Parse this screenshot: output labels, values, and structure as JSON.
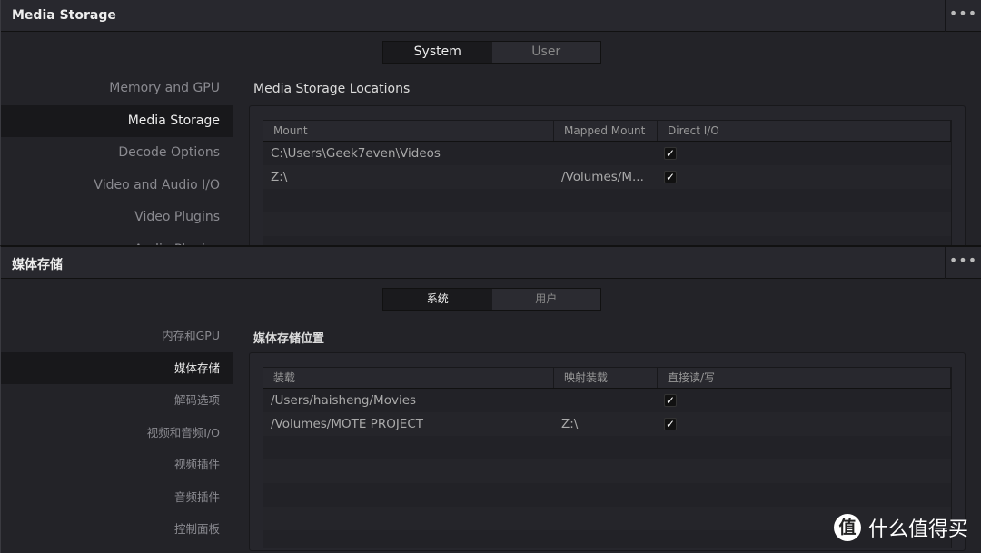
{
  "panels": [
    {
      "title": "Media Storage",
      "tabs": [
        "System",
        "User"
      ],
      "sidebar": [
        "Memory and GPU",
        "Media Storage",
        "Decode Options",
        "Video and Audio I/O",
        "Video Plugins",
        "Audio Plugins"
      ],
      "heading": "Media Storage Locations",
      "columns": [
        "Mount",
        "Mapped Mount",
        "Direct I/O"
      ],
      "rows": [
        {
          "mount": "C:\\Users\\Geek7even\\Videos",
          "mapped": "",
          "direct_io": true
        },
        {
          "mount": "Z:\\",
          "mapped": "/Volumes/M...",
          "direct_io": true
        }
      ]
    },
    {
      "title": "媒体存储",
      "tabs": [
        "系统",
        "用户"
      ],
      "sidebar": [
        "内存和GPU",
        "媒体存储",
        "解码选项",
        "视频和音频I/O",
        "视频插件",
        "音频插件",
        "控制面板"
      ],
      "heading": "媒体存储位置",
      "columns": [
        "装载",
        "映射装载",
        "直接读/写"
      ],
      "rows": [
        {
          "mount": "/Users/haisheng/Movies",
          "mapped": "",
          "direct_io": true
        },
        {
          "mount": "/Volumes/MOTE PROJECT",
          "mapped": "Z:\\",
          "direct_io": true
        }
      ]
    }
  ],
  "more_icon": "ellipsis-icon",
  "checkmark": "✓",
  "watermark": {
    "logo": "值",
    "text": "什么值得买"
  }
}
